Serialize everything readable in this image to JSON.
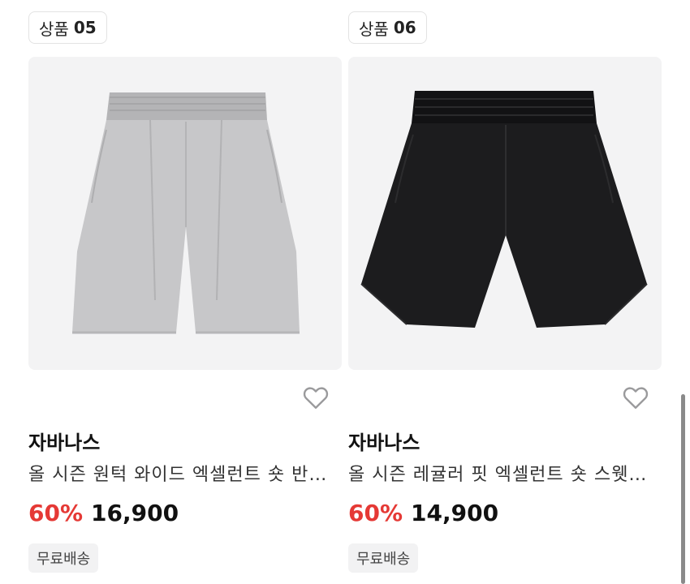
{
  "products": [
    {
      "tag_prefix": "상품",
      "tag_number": "05",
      "image_icon": "gray-shorts-image",
      "image_color": "#c7c7c9",
      "brand": "자바나스",
      "title": "올 시즌 원턱 와이드 엑셀런트 숏 반바지",
      "discount": "60%",
      "price": "16,900",
      "badge": "무료배송",
      "wishlist_icon": "heart-outline-icon"
    },
    {
      "tag_prefix": "상품",
      "tag_number": "06",
      "image_icon": "black-shorts-image",
      "image_color": "#1c1c1e",
      "brand": "자바나스",
      "title": "올 시즌 레귤러 핏 엑셀런트 숏 스웻 반바지",
      "discount": "60%",
      "price": "14,900",
      "badge": "무료배송",
      "wishlist_icon": "heart-outline-icon"
    }
  ],
  "colors": {
    "discount": "#e53935",
    "image_background": "#f3f3f4",
    "badge_background": "#f2f2f3"
  }
}
